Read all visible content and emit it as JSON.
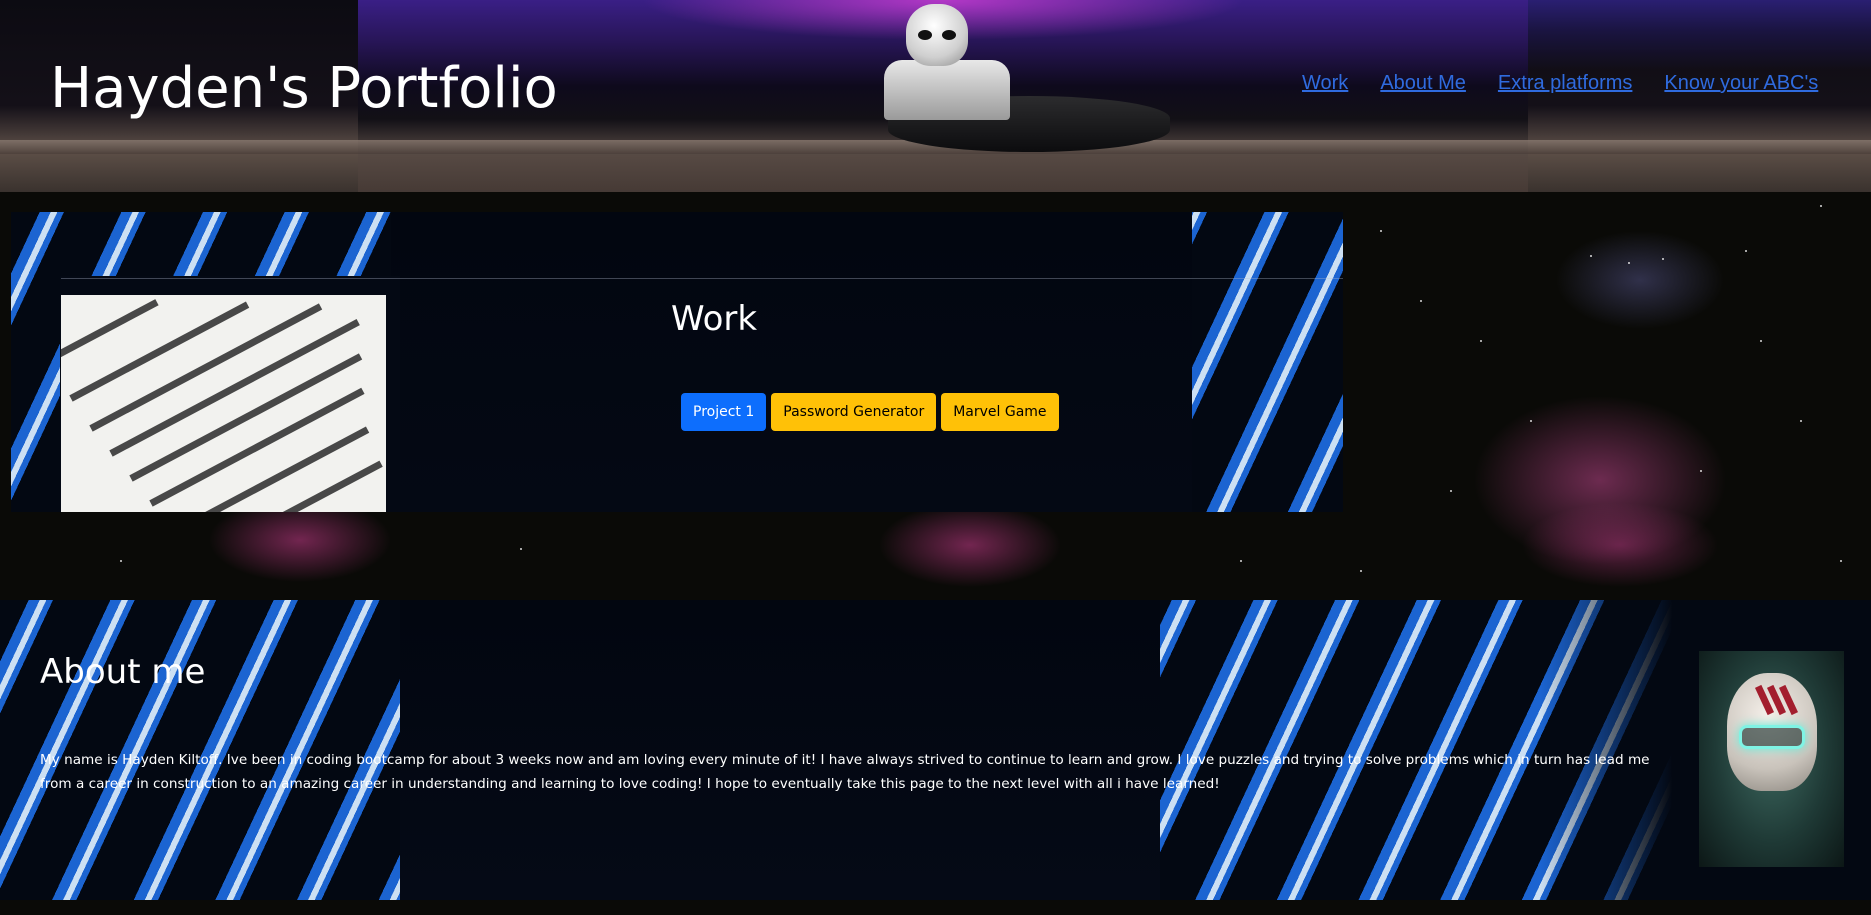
{
  "header": {
    "title": "Hayden's Portfolio",
    "nav": [
      "Work",
      "About Me",
      "Extra platforms",
      "Know your ABC's"
    ]
  },
  "work": {
    "heading": "Work",
    "buttons": [
      "Project 1",
      "Password Generator",
      "Marvel Game"
    ]
  },
  "about": {
    "heading": "About me",
    "text": "My name is Hayden Kiltoff. Ive been in coding bootcamp for about 3 weeks now and am loving every minute of it! I have always strived to continue to learn and grow. I love puzzles and trying to solve problems which in turn has lead me from a career in construction to an amazing career in understanding and learning to love coding! I hope to eventually take this page to the next level with all i have learned!"
  },
  "colors": {
    "link": "#2f6bdf",
    "primary_button": "#0d6efd",
    "warning_button": "#ffc107"
  }
}
